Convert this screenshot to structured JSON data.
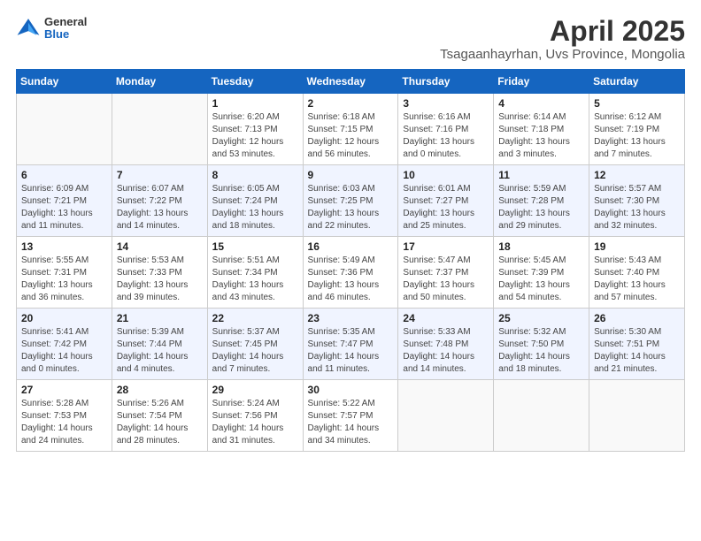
{
  "logo": {
    "general": "General",
    "blue": "Blue"
  },
  "title": "April 2025",
  "subtitle": "Tsagaanhayrhan, Uvs Province, Mongolia",
  "weekdays": [
    "Sunday",
    "Monday",
    "Tuesday",
    "Wednesday",
    "Thursday",
    "Friday",
    "Saturday"
  ],
  "weeks": [
    [
      {
        "day": "",
        "info": ""
      },
      {
        "day": "",
        "info": ""
      },
      {
        "day": "1",
        "info": "Sunrise: 6:20 AM\nSunset: 7:13 PM\nDaylight: 12 hours and 53 minutes."
      },
      {
        "day": "2",
        "info": "Sunrise: 6:18 AM\nSunset: 7:15 PM\nDaylight: 12 hours and 56 minutes."
      },
      {
        "day": "3",
        "info": "Sunrise: 6:16 AM\nSunset: 7:16 PM\nDaylight: 13 hours and 0 minutes."
      },
      {
        "day": "4",
        "info": "Sunrise: 6:14 AM\nSunset: 7:18 PM\nDaylight: 13 hours and 3 minutes."
      },
      {
        "day": "5",
        "info": "Sunrise: 6:12 AM\nSunset: 7:19 PM\nDaylight: 13 hours and 7 minutes."
      }
    ],
    [
      {
        "day": "6",
        "info": "Sunrise: 6:09 AM\nSunset: 7:21 PM\nDaylight: 13 hours and 11 minutes."
      },
      {
        "day": "7",
        "info": "Sunrise: 6:07 AM\nSunset: 7:22 PM\nDaylight: 13 hours and 14 minutes."
      },
      {
        "day": "8",
        "info": "Sunrise: 6:05 AM\nSunset: 7:24 PM\nDaylight: 13 hours and 18 minutes."
      },
      {
        "day": "9",
        "info": "Sunrise: 6:03 AM\nSunset: 7:25 PM\nDaylight: 13 hours and 22 minutes."
      },
      {
        "day": "10",
        "info": "Sunrise: 6:01 AM\nSunset: 7:27 PM\nDaylight: 13 hours and 25 minutes."
      },
      {
        "day": "11",
        "info": "Sunrise: 5:59 AM\nSunset: 7:28 PM\nDaylight: 13 hours and 29 minutes."
      },
      {
        "day": "12",
        "info": "Sunrise: 5:57 AM\nSunset: 7:30 PM\nDaylight: 13 hours and 32 minutes."
      }
    ],
    [
      {
        "day": "13",
        "info": "Sunrise: 5:55 AM\nSunset: 7:31 PM\nDaylight: 13 hours and 36 minutes."
      },
      {
        "day": "14",
        "info": "Sunrise: 5:53 AM\nSunset: 7:33 PM\nDaylight: 13 hours and 39 minutes."
      },
      {
        "day": "15",
        "info": "Sunrise: 5:51 AM\nSunset: 7:34 PM\nDaylight: 13 hours and 43 minutes."
      },
      {
        "day": "16",
        "info": "Sunrise: 5:49 AM\nSunset: 7:36 PM\nDaylight: 13 hours and 46 minutes."
      },
      {
        "day": "17",
        "info": "Sunrise: 5:47 AM\nSunset: 7:37 PM\nDaylight: 13 hours and 50 minutes."
      },
      {
        "day": "18",
        "info": "Sunrise: 5:45 AM\nSunset: 7:39 PM\nDaylight: 13 hours and 54 minutes."
      },
      {
        "day": "19",
        "info": "Sunrise: 5:43 AM\nSunset: 7:40 PM\nDaylight: 13 hours and 57 minutes."
      }
    ],
    [
      {
        "day": "20",
        "info": "Sunrise: 5:41 AM\nSunset: 7:42 PM\nDaylight: 14 hours and 0 minutes."
      },
      {
        "day": "21",
        "info": "Sunrise: 5:39 AM\nSunset: 7:44 PM\nDaylight: 14 hours and 4 minutes."
      },
      {
        "day": "22",
        "info": "Sunrise: 5:37 AM\nSunset: 7:45 PM\nDaylight: 14 hours and 7 minutes."
      },
      {
        "day": "23",
        "info": "Sunrise: 5:35 AM\nSunset: 7:47 PM\nDaylight: 14 hours and 11 minutes."
      },
      {
        "day": "24",
        "info": "Sunrise: 5:33 AM\nSunset: 7:48 PM\nDaylight: 14 hours and 14 minutes."
      },
      {
        "day": "25",
        "info": "Sunrise: 5:32 AM\nSunset: 7:50 PM\nDaylight: 14 hours and 18 minutes."
      },
      {
        "day": "26",
        "info": "Sunrise: 5:30 AM\nSunset: 7:51 PM\nDaylight: 14 hours and 21 minutes."
      }
    ],
    [
      {
        "day": "27",
        "info": "Sunrise: 5:28 AM\nSunset: 7:53 PM\nDaylight: 14 hours and 24 minutes."
      },
      {
        "day": "28",
        "info": "Sunrise: 5:26 AM\nSunset: 7:54 PM\nDaylight: 14 hours and 28 minutes."
      },
      {
        "day": "29",
        "info": "Sunrise: 5:24 AM\nSunset: 7:56 PM\nDaylight: 14 hours and 31 minutes."
      },
      {
        "day": "30",
        "info": "Sunrise: 5:22 AM\nSunset: 7:57 PM\nDaylight: 14 hours and 34 minutes."
      },
      {
        "day": "",
        "info": ""
      },
      {
        "day": "",
        "info": ""
      },
      {
        "day": "",
        "info": ""
      }
    ]
  ]
}
